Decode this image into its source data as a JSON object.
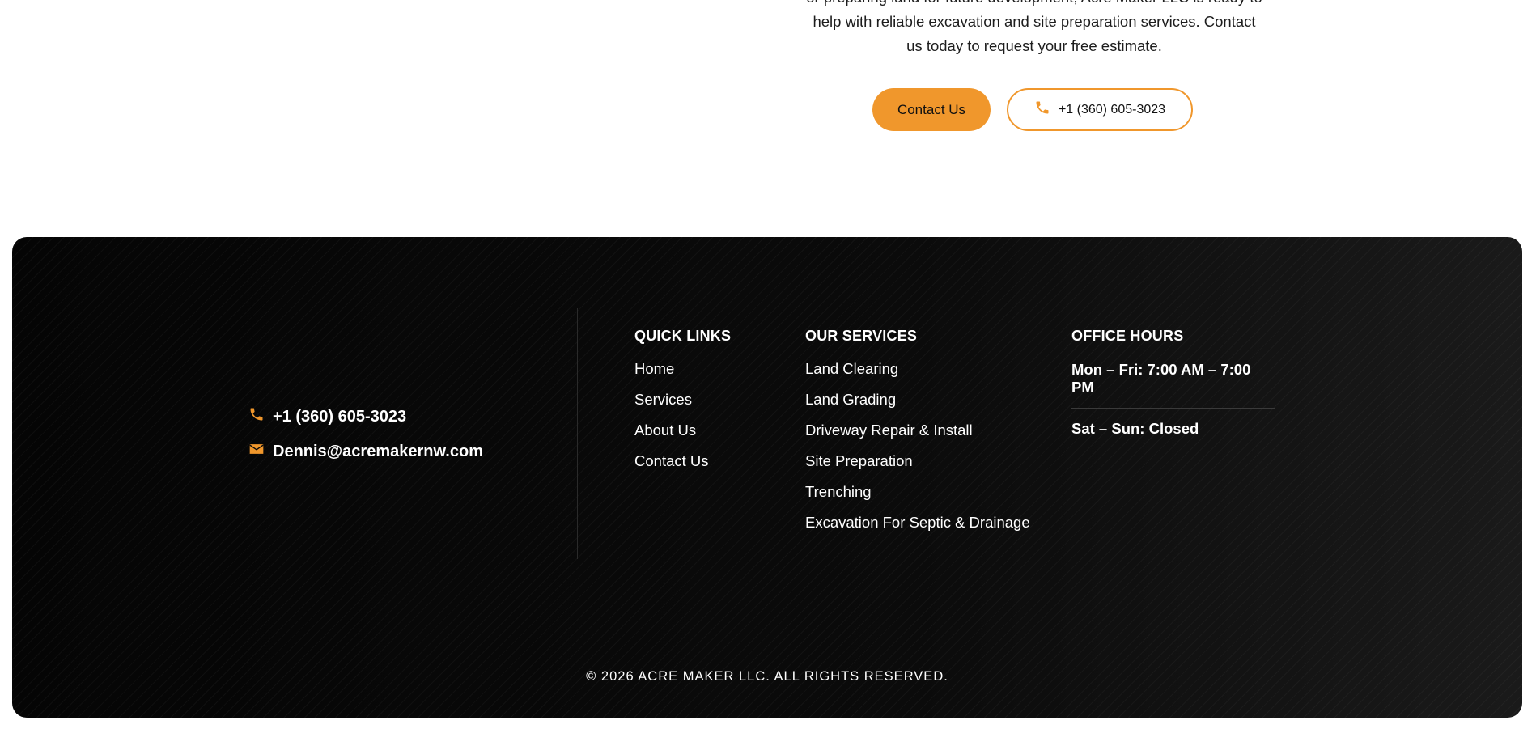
{
  "cta": {
    "text_lines": [
      "or preparing land for future development, Acre Maker LLC is ready to",
      "help with reliable excavation and site preparation services. Contact",
      "us today to request your free estimate."
    ],
    "contact_button": "Contact Us",
    "phone_button": "+1 (360) 605-3023"
  },
  "footer": {
    "phone": "+1 (360) 605-3023",
    "email": "Dennis@acremakernw.com",
    "quick_links": {
      "heading": "QUICK LINKS",
      "items": [
        "Home",
        "Services",
        "About Us",
        "Contact Us"
      ]
    },
    "services": {
      "heading": "OUR SERVICES",
      "items": [
        "Land Clearing",
        "Land Grading",
        "Driveway Repair & Install",
        "Site Preparation",
        "Trenching",
        "Excavation For Septic & Drainage"
      ]
    },
    "hours": {
      "heading": "OFFICE HOURS",
      "weekday": "Mon – Fri: 7:00 AM – 7:00 PM",
      "weekend": "Sat – Sun: Closed"
    },
    "copyright": "© 2026 ACRE MAKER LLC. ALL RIGHTS RESERVED."
  },
  "colors": {
    "accent": "#f0972c",
    "footer_bg": "#0a0a0a"
  },
  "icons": [
    "phone-icon",
    "email-icon"
  ]
}
